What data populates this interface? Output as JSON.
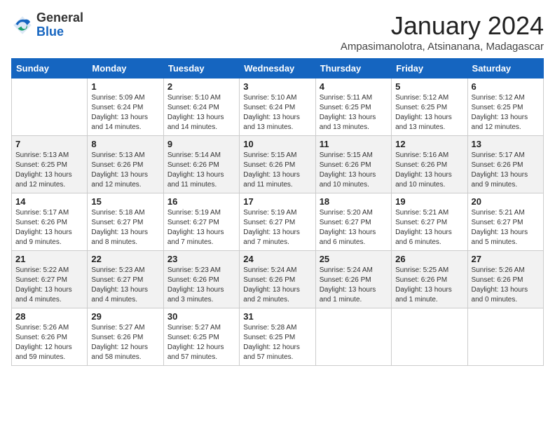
{
  "header": {
    "logo_general": "General",
    "logo_blue": "Blue",
    "month": "January 2024",
    "location": "Ampasimanolotra, Atsinanana, Madagascar"
  },
  "weekdays": [
    "Sunday",
    "Monday",
    "Tuesday",
    "Wednesday",
    "Thursday",
    "Friday",
    "Saturday"
  ],
  "weeks": [
    [
      {
        "day": "",
        "sunrise": "",
        "sunset": "",
        "daylight": ""
      },
      {
        "day": "1",
        "sunrise": "Sunrise: 5:09 AM",
        "sunset": "Sunset: 6:24 PM",
        "daylight": "Daylight: 13 hours and 14 minutes."
      },
      {
        "day": "2",
        "sunrise": "Sunrise: 5:10 AM",
        "sunset": "Sunset: 6:24 PM",
        "daylight": "Daylight: 13 hours and 14 minutes."
      },
      {
        "day": "3",
        "sunrise": "Sunrise: 5:10 AM",
        "sunset": "Sunset: 6:24 PM",
        "daylight": "Daylight: 13 hours and 13 minutes."
      },
      {
        "day": "4",
        "sunrise": "Sunrise: 5:11 AM",
        "sunset": "Sunset: 6:25 PM",
        "daylight": "Daylight: 13 hours and 13 minutes."
      },
      {
        "day": "5",
        "sunrise": "Sunrise: 5:12 AM",
        "sunset": "Sunset: 6:25 PM",
        "daylight": "Daylight: 13 hours and 13 minutes."
      },
      {
        "day": "6",
        "sunrise": "Sunrise: 5:12 AM",
        "sunset": "Sunset: 6:25 PM",
        "daylight": "Daylight: 13 hours and 12 minutes."
      }
    ],
    [
      {
        "day": "7",
        "sunrise": "Sunrise: 5:13 AM",
        "sunset": "Sunset: 6:25 PM",
        "daylight": "Daylight: 13 hours and 12 minutes."
      },
      {
        "day": "8",
        "sunrise": "Sunrise: 5:13 AM",
        "sunset": "Sunset: 6:26 PM",
        "daylight": "Daylight: 13 hours and 12 minutes."
      },
      {
        "day": "9",
        "sunrise": "Sunrise: 5:14 AM",
        "sunset": "Sunset: 6:26 PM",
        "daylight": "Daylight: 13 hours and 11 minutes."
      },
      {
        "day": "10",
        "sunrise": "Sunrise: 5:15 AM",
        "sunset": "Sunset: 6:26 PM",
        "daylight": "Daylight: 13 hours and 11 minutes."
      },
      {
        "day": "11",
        "sunrise": "Sunrise: 5:15 AM",
        "sunset": "Sunset: 6:26 PM",
        "daylight": "Daylight: 13 hours and 10 minutes."
      },
      {
        "day": "12",
        "sunrise": "Sunrise: 5:16 AM",
        "sunset": "Sunset: 6:26 PM",
        "daylight": "Daylight: 13 hours and 10 minutes."
      },
      {
        "day": "13",
        "sunrise": "Sunrise: 5:17 AM",
        "sunset": "Sunset: 6:26 PM",
        "daylight": "Daylight: 13 hours and 9 minutes."
      }
    ],
    [
      {
        "day": "14",
        "sunrise": "Sunrise: 5:17 AM",
        "sunset": "Sunset: 6:26 PM",
        "daylight": "Daylight: 13 hours and 9 minutes."
      },
      {
        "day": "15",
        "sunrise": "Sunrise: 5:18 AM",
        "sunset": "Sunset: 6:27 PM",
        "daylight": "Daylight: 13 hours and 8 minutes."
      },
      {
        "day": "16",
        "sunrise": "Sunrise: 5:19 AM",
        "sunset": "Sunset: 6:27 PM",
        "daylight": "Daylight: 13 hours and 7 minutes."
      },
      {
        "day": "17",
        "sunrise": "Sunrise: 5:19 AM",
        "sunset": "Sunset: 6:27 PM",
        "daylight": "Daylight: 13 hours and 7 minutes."
      },
      {
        "day": "18",
        "sunrise": "Sunrise: 5:20 AM",
        "sunset": "Sunset: 6:27 PM",
        "daylight": "Daylight: 13 hours and 6 minutes."
      },
      {
        "day": "19",
        "sunrise": "Sunrise: 5:21 AM",
        "sunset": "Sunset: 6:27 PM",
        "daylight": "Daylight: 13 hours and 6 minutes."
      },
      {
        "day": "20",
        "sunrise": "Sunrise: 5:21 AM",
        "sunset": "Sunset: 6:27 PM",
        "daylight": "Daylight: 13 hours and 5 minutes."
      }
    ],
    [
      {
        "day": "21",
        "sunrise": "Sunrise: 5:22 AM",
        "sunset": "Sunset: 6:27 PM",
        "daylight": "Daylight: 13 hours and 4 minutes."
      },
      {
        "day": "22",
        "sunrise": "Sunrise: 5:23 AM",
        "sunset": "Sunset: 6:27 PM",
        "daylight": "Daylight: 13 hours and 4 minutes."
      },
      {
        "day": "23",
        "sunrise": "Sunrise: 5:23 AM",
        "sunset": "Sunset: 6:26 PM",
        "daylight": "Daylight: 13 hours and 3 minutes."
      },
      {
        "day": "24",
        "sunrise": "Sunrise: 5:24 AM",
        "sunset": "Sunset: 6:26 PM",
        "daylight": "Daylight: 13 hours and 2 minutes."
      },
      {
        "day": "25",
        "sunrise": "Sunrise: 5:24 AM",
        "sunset": "Sunset: 6:26 PM",
        "daylight": "Daylight: 13 hours and 1 minute."
      },
      {
        "day": "26",
        "sunrise": "Sunrise: 5:25 AM",
        "sunset": "Sunset: 6:26 PM",
        "daylight": "Daylight: 13 hours and 1 minute."
      },
      {
        "day": "27",
        "sunrise": "Sunrise: 5:26 AM",
        "sunset": "Sunset: 6:26 PM",
        "daylight": "Daylight: 13 hours and 0 minutes."
      }
    ],
    [
      {
        "day": "28",
        "sunrise": "Sunrise: 5:26 AM",
        "sunset": "Sunset: 6:26 PM",
        "daylight": "Daylight: 12 hours and 59 minutes."
      },
      {
        "day": "29",
        "sunrise": "Sunrise: 5:27 AM",
        "sunset": "Sunset: 6:26 PM",
        "daylight": "Daylight: 12 hours and 58 minutes."
      },
      {
        "day": "30",
        "sunrise": "Sunrise: 5:27 AM",
        "sunset": "Sunset: 6:25 PM",
        "daylight": "Daylight: 12 hours and 57 minutes."
      },
      {
        "day": "31",
        "sunrise": "Sunrise: 5:28 AM",
        "sunset": "Sunset: 6:25 PM",
        "daylight": "Daylight: 12 hours and 57 minutes."
      },
      {
        "day": "",
        "sunrise": "",
        "sunset": "",
        "daylight": ""
      },
      {
        "day": "",
        "sunrise": "",
        "sunset": "",
        "daylight": ""
      },
      {
        "day": "",
        "sunrise": "",
        "sunset": "",
        "daylight": ""
      }
    ]
  ]
}
